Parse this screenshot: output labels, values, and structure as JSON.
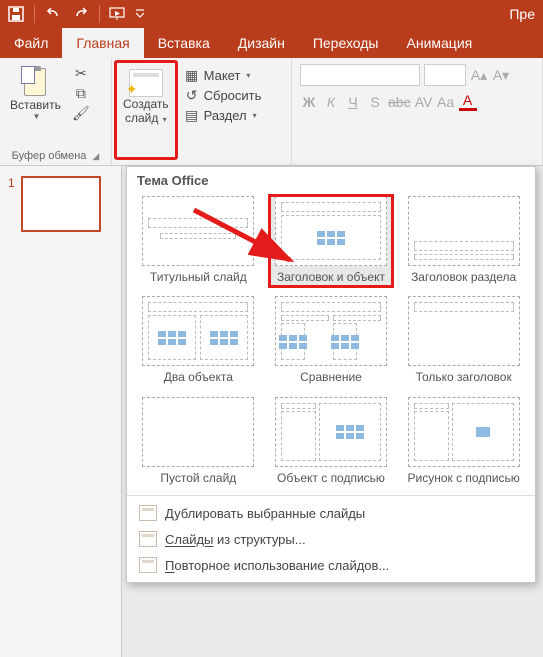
{
  "title_partial": "Пре",
  "tabs": {
    "file": "Файл",
    "home": "Главная",
    "insert": "Вставка",
    "design": "Дизайн",
    "transitions": "Переходы",
    "animations": "Анимация"
  },
  "ribbon": {
    "clipboard_group": "Буфер обмена",
    "paste": "Вставить",
    "new_slide_line1": "Создать",
    "new_slide_line2": "слайд",
    "layout": "Макет",
    "reset": "Сбросить",
    "section": "Раздел"
  },
  "font_toolbar": {
    "strike": "Ж",
    "italic": "К",
    "under": "Ч",
    "shadow": "S",
    "strike2": "abc",
    "spacing": "AV",
    "caps": "Aa",
    "color": "A"
  },
  "thumb": {
    "num": "1"
  },
  "gallery": {
    "title": "Тема Office",
    "items": [
      {
        "label": "Титульный слайд",
        "type": "title"
      },
      {
        "label": "Заголовок и объект",
        "type": "title_content",
        "selected": true
      },
      {
        "label": "Заголовок раздела",
        "type": "section"
      },
      {
        "label": "Два объекта",
        "type": "two"
      },
      {
        "label": "Сравнение",
        "type": "compare"
      },
      {
        "label": "Только заголовок",
        "type": "only_title"
      },
      {
        "label": "Пустой слайд",
        "type": "blank"
      },
      {
        "label": "Объект с подписью",
        "type": "obj_caption"
      },
      {
        "label": "Рисунок с подписью",
        "type": "pic_caption"
      }
    ],
    "footer": {
      "duplicate": "Дублировать выбранные слайды",
      "outline": "Слайды из структуры...",
      "reuse": "Повторное использование слайдов..."
    }
  }
}
